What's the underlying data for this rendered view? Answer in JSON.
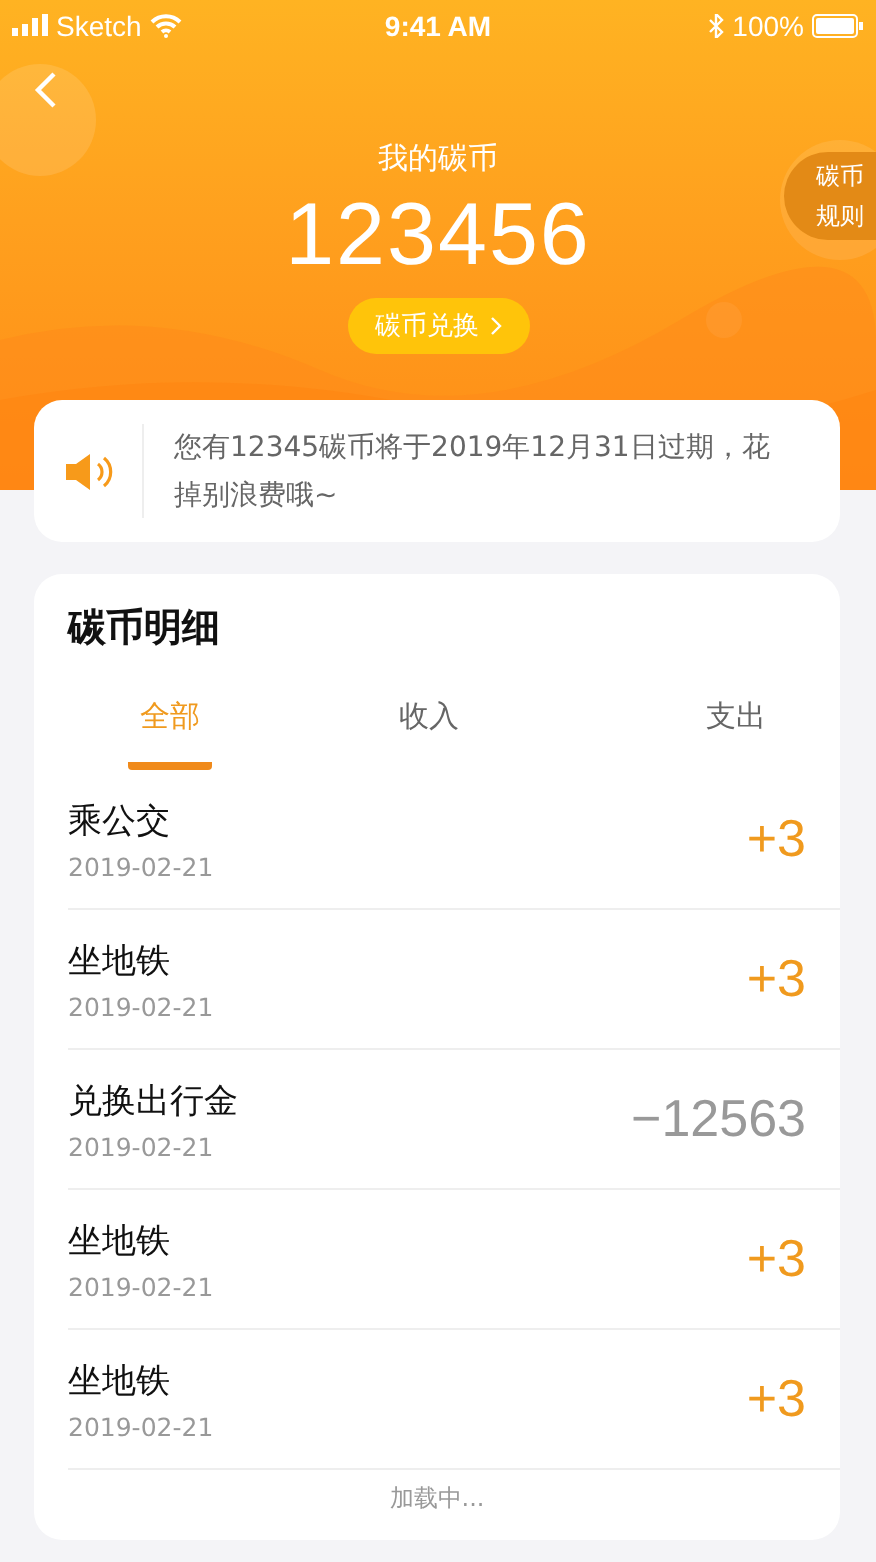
{
  "status_bar": {
    "carrier": "Sketch",
    "time": "9:41 AM",
    "battery": "100%"
  },
  "header": {
    "title": "我的碳币",
    "balance": "123456",
    "exchange_button": "碳币兑换",
    "rules_button": "碳币规则"
  },
  "notice": {
    "text": "您有12345碳币将于2019年12月31日过期，花掉别浪费哦~"
  },
  "detail": {
    "title": "碳币明细",
    "tabs": [
      {
        "label": "全部",
        "selected": true
      },
      {
        "label": "收入",
        "selected": false
      },
      {
        "label": "支出",
        "selected": false
      }
    ],
    "rows": [
      {
        "name": "乘公交",
        "date": "2019-02-21",
        "amount": "+3",
        "kind": "income"
      },
      {
        "name": "坐地铁",
        "date": "2019-02-21",
        "amount": "+3",
        "kind": "income"
      },
      {
        "name": "兑换出行金",
        "date": "2019-02-21",
        "amount": "−12563",
        "kind": "expense"
      },
      {
        "name": "坐地铁",
        "date": "2019-02-21",
        "amount": "+3",
        "kind": "income"
      },
      {
        "name": "坐地铁",
        "date": "2019-02-21",
        "amount": "+3",
        "kind": "income"
      }
    ],
    "loading": "加载中..."
  }
}
